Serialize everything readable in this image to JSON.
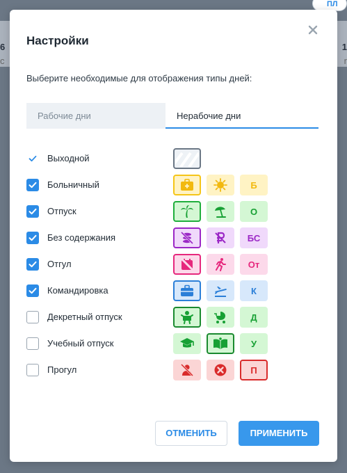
{
  "background": {
    "left_glyphs": [
      "6",
      "c"
    ],
    "right_glyphs": [
      "1",
      "r"
    ],
    "top_button": "ПЛ"
  },
  "modal": {
    "title": "Настройки",
    "subtitle": "Выберите необходимые для отображения типы дней:",
    "tabs": [
      {
        "label": "Рабочие дни",
        "active": false
      },
      {
        "label": "Нерабочие дни",
        "active": true
      }
    ],
    "rows": [
      {
        "label": "Выходной",
        "state": "tick",
        "cells": [
          {
            "kind": "hatch",
            "bg": "#eef2f6",
            "border": "#6b7785",
            "color": "#c7d0d9",
            "text": "",
            "icon": "hatch-pattern-icon"
          }
        ]
      },
      {
        "label": "Больничный",
        "state": "checked",
        "cells": [
          {
            "kind": "icon",
            "bg": "#fff3c4",
            "border": "#f5c518",
            "color": "#f2b90f",
            "text": "",
            "icon": "first-aid-kit-icon"
          },
          {
            "kind": "icon",
            "bg": "#fff3c4",
            "border": "",
            "color": "#f2b90f",
            "text": "",
            "icon": "virus-icon"
          },
          {
            "kind": "text",
            "bg": "#fff3c4",
            "border": "",
            "color": "#f2b90f",
            "text": "Б",
            "icon": ""
          }
        ]
      },
      {
        "label": "Отпуск",
        "state": "checked",
        "cells": [
          {
            "kind": "icon",
            "bg": "#d4f7d4",
            "border": "#1fae3c",
            "color": "#17a034",
            "text": "",
            "icon": "palm-tree-icon"
          },
          {
            "kind": "icon",
            "bg": "#d4f7d4",
            "border": "",
            "color": "#17a034",
            "text": "",
            "icon": "beach-umbrella-icon"
          },
          {
            "kind": "text",
            "bg": "#d4f7d4",
            "border": "",
            "color": "#17a034",
            "text": "О",
            "icon": ""
          }
        ]
      },
      {
        "label": "Без содержания",
        "state": "checked",
        "cells": [
          {
            "kind": "icon",
            "bg": "#f0d9fb",
            "border": "#9b27c6",
            "color": "#9b27c6",
            "text": "",
            "icon": "no-money-icon"
          },
          {
            "kind": "icon",
            "bg": "#f0d9fb",
            "border": "",
            "color": "#9b27c6",
            "text": "",
            "icon": "ruble-crossed-icon"
          },
          {
            "kind": "text",
            "bg": "#f0d9fb",
            "border": "",
            "color": "#9b27c6",
            "text": "БС",
            "icon": ""
          }
        ]
      },
      {
        "label": "Отгул",
        "state": "checked",
        "cells": [
          {
            "kind": "icon",
            "bg": "#fcd9ea",
            "border": "#e6287d",
            "color": "#e6287d",
            "text": "",
            "icon": "calendar-off-icon"
          },
          {
            "kind": "icon",
            "bg": "#fcd9ea",
            "border": "",
            "color": "#e6287d",
            "text": "",
            "icon": "running-person-icon"
          },
          {
            "kind": "text",
            "bg": "#fcd9ea",
            "border": "",
            "color": "#e6287d",
            "text": "От",
            "icon": ""
          }
        ]
      },
      {
        "label": "Командировка",
        "state": "checked",
        "cells": [
          {
            "kind": "icon",
            "bg": "#d7e8fb",
            "border": "#2b7fd8",
            "color": "#2b7fd8",
            "text": "",
            "icon": "briefcase-icon"
          },
          {
            "kind": "icon",
            "bg": "#d7e8fb",
            "border": "",
            "color": "#2b7fd8",
            "text": "",
            "icon": "airplane-icon"
          },
          {
            "kind": "text",
            "bg": "#d7e8fb",
            "border": "",
            "color": "#2b7fd8",
            "text": "К",
            "icon": ""
          }
        ]
      },
      {
        "label": "Декретный отпуск",
        "state": "unchecked",
        "cells": [
          {
            "kind": "icon",
            "bg": "#d4f7d4",
            "border": "#1a8a2f",
            "color": "#17a034",
            "text": "",
            "icon": "baby-icon"
          },
          {
            "kind": "icon",
            "bg": "#d4f7d4",
            "border": "",
            "color": "#17a034",
            "text": "",
            "icon": "stroller-icon"
          },
          {
            "kind": "text",
            "bg": "#d4f7d4",
            "border": "",
            "color": "#17a034",
            "text": "Д",
            "icon": ""
          }
        ]
      },
      {
        "label": "Учебный отпуск",
        "state": "unchecked",
        "cells": [
          {
            "kind": "icon",
            "bg": "#d4f7d4",
            "border": "",
            "color": "#17a034",
            "text": "",
            "icon": "graduation-cap-icon"
          },
          {
            "kind": "icon",
            "bg": "#d4f7d4",
            "border": "#1a8a2f",
            "color": "#17a034",
            "text": "",
            "icon": "open-book-icon"
          },
          {
            "kind": "text",
            "bg": "#d4f7d4",
            "border": "",
            "color": "#17a034",
            "text": "У",
            "icon": ""
          }
        ]
      },
      {
        "label": "Прогул",
        "state": "unchecked",
        "cells": [
          {
            "kind": "icon",
            "bg": "#fbd5d5",
            "border": "",
            "color": "#d92b2b",
            "text": "",
            "icon": "person-off-icon"
          },
          {
            "kind": "icon",
            "bg": "#fbd5d5",
            "border": "",
            "color": "#d92b2b",
            "text": "",
            "icon": "x-circle-icon"
          },
          {
            "kind": "text",
            "bg": "#fbd5d5",
            "border": "#d92b2b",
            "color": "#d92b2b",
            "text": "П",
            "icon": ""
          }
        ]
      }
    ],
    "buttons": {
      "cancel": "ОТМЕНИТЬ",
      "apply": "ПРИМЕНИТЬ"
    },
    "colors": {
      "accent": "#2b8be6",
      "apply_bg": "#3898ec"
    }
  }
}
